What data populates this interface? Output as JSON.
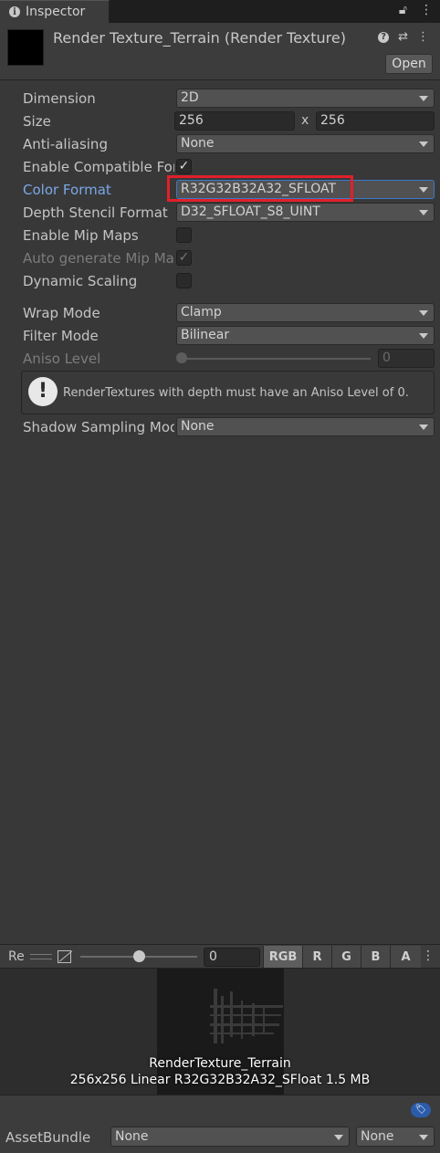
{
  "tab": {
    "title": "Inspector"
  },
  "header": {
    "asset_title": "Render Texture_Terrain (Render Texture)",
    "open_label": "Open"
  },
  "properties": {
    "dimension": {
      "label": "Dimension",
      "value": "2D"
    },
    "size": {
      "label": "Size",
      "width": "256",
      "x": "x",
      "height": "256"
    },
    "anti_aliasing": {
      "label": "Anti-aliasing",
      "value": "None"
    },
    "enable_compatible_format": {
      "label": "Enable Compatible Format",
      "checked": "✓"
    },
    "color_format": {
      "label": "Color Format",
      "value": "R32G32B32A32_SFLOAT"
    },
    "depth_stencil_format": {
      "label": "Depth Stencil Format",
      "value": "D32_SFLOAT_S8_UINT"
    },
    "enable_mip_maps": {
      "label": "Enable Mip Maps",
      "checked": ""
    },
    "auto_generate_mip_maps": {
      "label": "Auto generate Mip Maps",
      "checked": "✓"
    },
    "dynamic_scaling": {
      "label": "Dynamic Scaling",
      "checked": ""
    },
    "wrap_mode": {
      "label": "Wrap Mode",
      "value": "Clamp"
    },
    "filter_mode": {
      "label": "Filter Mode",
      "value": "Bilinear"
    },
    "aniso_level": {
      "label": "Aniso Level",
      "value": "0"
    },
    "help_message": "RenderTextures with depth must have an Aniso Level of 0.",
    "shadow_sampling_mode": {
      "label": "Shadow Sampling Mode",
      "value": "None"
    }
  },
  "preview_toolbar": {
    "label": "Re",
    "mip_value": "0",
    "channels": [
      "RGB",
      "R",
      "G",
      "B",
      "A"
    ]
  },
  "preview": {
    "name": "RenderTexture_Terrain",
    "info": "256x256 Linear  R32G32B32A32_SFloat  1.5 MB"
  },
  "asset_bundle": {
    "label": "AssetBundle",
    "name": "None",
    "variant": "None"
  },
  "colors": {
    "accent": "#7ba8e8",
    "highlight": "#e0202a",
    "background": "#383838"
  }
}
